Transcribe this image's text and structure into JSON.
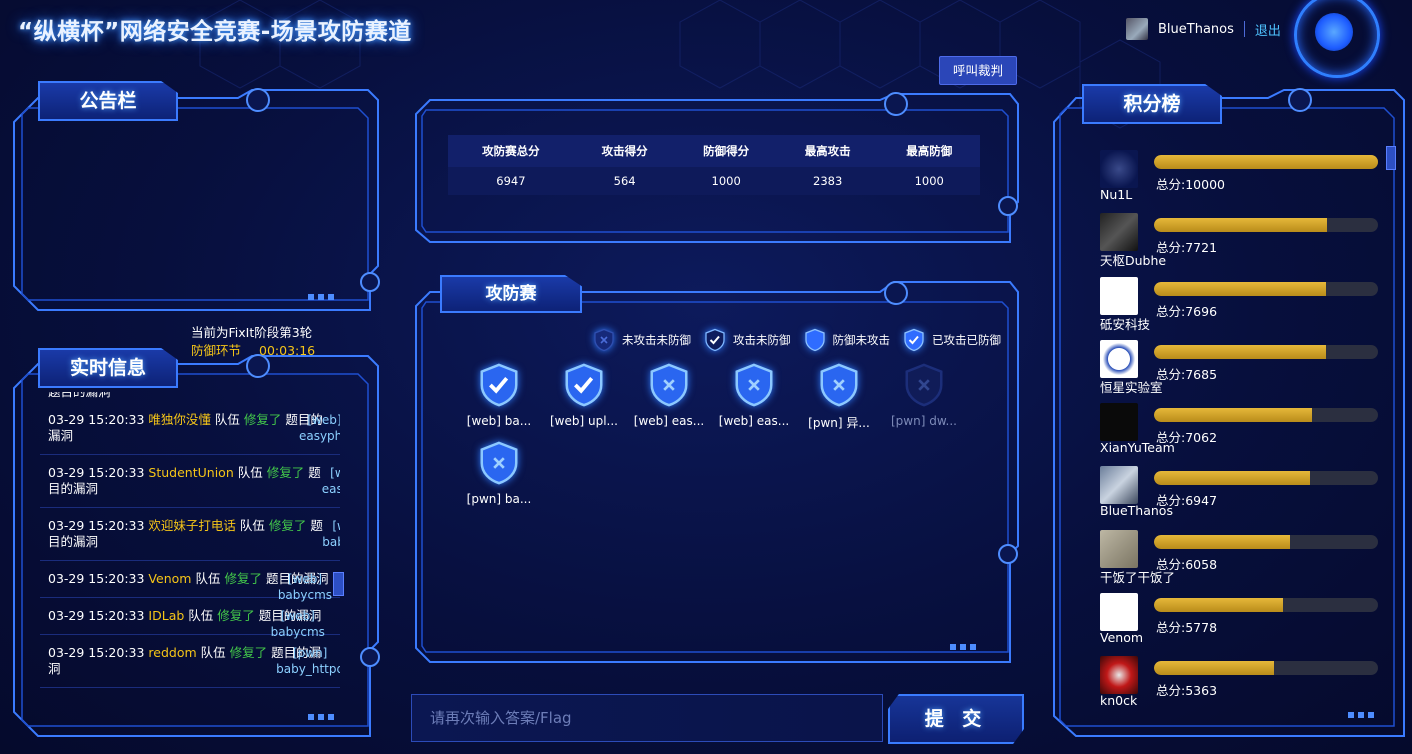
{
  "header": {
    "title": "“纵横杯”网络安全竞赛-场景攻防赛道",
    "username": "BlueThanos",
    "logout_label": "退出",
    "call_referee_label": "呼叫裁判"
  },
  "panels": {
    "announcement_title": "公告栏",
    "realtime_title": "实时信息",
    "attack_defense_title": "攻防赛",
    "scoreboard_title": "积分榜"
  },
  "round_info": {
    "line1": "当前为FixIt阶段第3轮",
    "stage": "防御环节",
    "timer": "00:03:16"
  },
  "feed": {
    "partial_top": "题目的漏洞",
    "items": [
      {
        "time": "03-29 15:20:33",
        "team": "唯独你没懂",
        "team_word": "队伍",
        "action": "修复了",
        "challenge": "[web] easyphp",
        "suffix": "题目的漏洞"
      },
      {
        "time": "03-29 15:20:33",
        "team": "StudentUnion",
        "team_word": "队伍",
        "action": "修复了",
        "challenge": "[web] easyphp",
        "suffix": "题目的漏洞"
      },
      {
        "time": "03-29 15:20:33",
        "team": "欢迎妹子打电话",
        "team_word": "队伍",
        "action": "修复了",
        "challenge": "[web] babycms",
        "suffix": "题目的漏洞"
      },
      {
        "time": "03-29 15:20:33",
        "team": "Venom",
        "team_word": "队伍",
        "action": "修复了",
        "challenge": "[web] babycms",
        "suffix": "题目的漏洞"
      },
      {
        "time": "03-29 15:20:33",
        "team": "IDLab",
        "team_word": "队伍",
        "action": "修复了",
        "challenge": "[web] babycms",
        "suffix": "题目的漏洞"
      },
      {
        "time": "03-29 15:20:33",
        "team": "reddom",
        "team_word": "队伍",
        "action": "修复了",
        "challenge": "[pwn] baby_httpd",
        "suffix": "题目的漏洞"
      }
    ]
  },
  "stats": {
    "headers": [
      "攻防赛总分",
      "攻击得分",
      "防御得分",
      "最高攻击",
      "最高防御"
    ],
    "values": [
      "6947",
      "564",
      "1000",
      "2383",
      "1000"
    ]
  },
  "legend": [
    {
      "label": "未攻击未防御",
      "state": "none"
    },
    {
      "label": "攻击未防御",
      "state": "attack"
    },
    {
      "label": "防御未攻击",
      "state": "defend"
    },
    {
      "label": "已攻击已防御",
      "state": "both"
    }
  ],
  "challenges": [
    {
      "label": "[web] ba...",
      "state": "checked"
    },
    {
      "label": "[web] upl...",
      "state": "checked"
    },
    {
      "label": "[web] eas...",
      "state": "defended"
    },
    {
      "label": "[web] eas...",
      "state": "defended"
    },
    {
      "label": "[pwn] 异...",
      "state": "defended"
    },
    {
      "label": "[pwn] dw...",
      "state": "inactive"
    },
    {
      "label": "[pwn] ba...",
      "state": "defended"
    }
  ],
  "answer": {
    "placeholder": "请再次输入答案/Flag",
    "submit_label": "提 交"
  },
  "scoreboard": {
    "max_score": 10000,
    "teams": [
      {
        "name": "Nu1L",
        "score_label": "总分:10000",
        "score": 10000,
        "logo": "nu1l-logo"
      },
      {
        "name": "天枢Dubhe",
        "score_label": "总分:7721",
        "score": 7721,
        "logo": "dubhe-logo"
      },
      {
        "name": "砥安科技",
        "score_label": "总分:7696",
        "score": 7696,
        "logo": "dian-logo"
      },
      {
        "name": "恒星实验室",
        "score_label": "总分:7685",
        "score": 7685,
        "logo": "hengxing-logo"
      },
      {
        "name": "XianYuTeam",
        "score_label": "总分:7062",
        "score": 7062,
        "logo": "xianyu-logo"
      },
      {
        "name": "BlueThanos",
        "score_label": "总分:6947",
        "score": 6947,
        "logo": "bluethanos-logo"
      },
      {
        "name": "干饭了干饭了",
        "score_label": "总分:6058",
        "score": 6058,
        "logo": "ganfan-logo"
      },
      {
        "name": "Venom",
        "score_label": "总分:5778",
        "score": 5778,
        "logo": "venom-logo"
      },
      {
        "name": "kn0ck",
        "score_label": "总分:5363",
        "score": 5363,
        "logo": "kn0ck-logo"
      }
    ]
  },
  "colors": {
    "accent": "#3b7bff",
    "team_name": "#f5c518",
    "fixed": "#43c84a",
    "challenge": "#8cd0ff",
    "bar_fill": "#d4a628"
  }
}
